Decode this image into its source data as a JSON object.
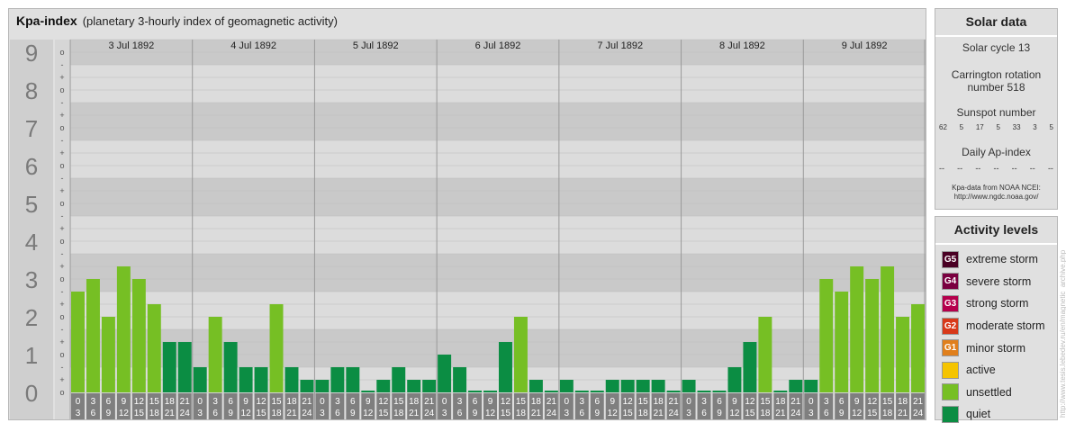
{
  "header": {
    "title": "Kpa-index",
    "subtitle": "(planetary 3-hourly index of geomagnetic activity)"
  },
  "colors": {
    "quiet": "#0b8d43",
    "unsettled": "#76bf24",
    "active": "#f5c400",
    "g1": "#e07f1c",
    "g2": "#d8391a",
    "g3": "#b5004c",
    "g4": "#7a0040",
    "g5": "#4a0024"
  },
  "chart_data": {
    "type": "bar",
    "title": "Kpa-index",
    "ylim": [
      0,
      9
    ],
    "y_ticks": [
      "0",
      "1",
      "2",
      "3",
      "4",
      "5",
      "6",
      "7",
      "8",
      "9"
    ],
    "y_minor_marks": [
      "-",
      "o",
      "+"
    ],
    "days": [
      "3 Jul 1892",
      "4 Jul 1892",
      "5 Jul 1892",
      "6 Jul 1892",
      "7 Jul 1892",
      "8 Jul 1892",
      "9 Jul 1892"
    ],
    "hour_start": [
      "0",
      "3",
      "6",
      "9",
      "12",
      "15",
      "18",
      "21"
    ],
    "hour_end": [
      "3",
      "6",
      "9",
      "12",
      "15",
      "18",
      "21",
      "24"
    ],
    "values": [
      [
        2.667,
        3.0,
        2.0,
        3.333,
        3.0,
        2.333,
        1.333,
        1.333
      ],
      [
        0.667,
        2.0,
        1.333,
        0.667,
        0.667,
        2.333,
        0.667,
        0.333
      ],
      [
        0.333,
        0.667,
        0.667,
        0.0,
        0.333,
        0.667,
        0.333,
        0.333
      ],
      [
        1.0,
        0.667,
        0.0,
        0.0,
        1.333,
        2.0,
        0.333,
        0.0
      ],
      [
        0.333,
        0.0,
        0.0,
        0.333,
        0.333,
        0.333,
        0.333,
        0.0
      ],
      [
        0.333,
        0.0,
        0.0,
        0.667,
        1.333,
        2.0,
        0.0,
        0.333
      ],
      [
        0.333,
        3.0,
        2.667,
        3.333,
        3.0,
        3.333,
        2.0,
        2.333
      ]
    ],
    "categories": [
      "quiet",
      "quiet",
      "quiet",
      "quiet",
      "quiet",
      "unsettled",
      "unsettled",
      "unsettled",
      "unsettled"
    ],
    "grid": true
  },
  "solar": {
    "heading": "Solar data",
    "cycle": "Solar cycle 13",
    "carrington": "Carrington rotation number 518",
    "sunspot_heading": "Sunspot number",
    "sunspot_values": [
      "62",
      "5",
      "17",
      "5",
      "33",
      "3",
      "5"
    ],
    "ap_heading": "Daily Ap-index",
    "ap_values": [
      "--",
      "--",
      "--",
      "--",
      "--",
      "--",
      "--"
    ],
    "source_line1": "Kpa-data from NOAA NCEI:",
    "source_line2": "http://www.ngdc.noaa.gov/"
  },
  "activity": {
    "heading": "Activity levels",
    "levels": [
      {
        "badge": "G5",
        "label": "extreme storm",
        "color": "#4a0024"
      },
      {
        "badge": "G4",
        "label": "severe storm",
        "color": "#7a0040"
      },
      {
        "badge": "G3",
        "label": "strong storm",
        "color": "#b5004c"
      },
      {
        "badge": "G2",
        "label": "moderate storm",
        "color": "#d8391a"
      },
      {
        "badge": "G1",
        "label": "minor storm",
        "color": "#e07f1c"
      },
      {
        "badge": "",
        "label": "active",
        "color": "#f5c400"
      },
      {
        "badge": "",
        "label": "unsettled",
        "color": "#76bf24"
      },
      {
        "badge": "",
        "label": "quiet",
        "color": "#0b8d43"
      }
    ]
  },
  "watermark": "http://www.tesis.lebedev.ru/en/magnetic_archive.php"
}
